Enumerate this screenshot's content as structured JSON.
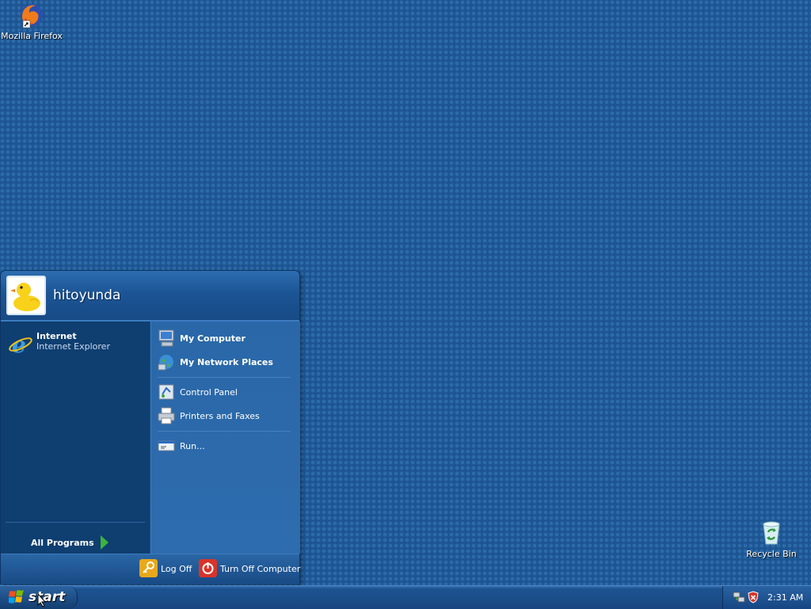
{
  "desktop": {
    "icons": [
      {
        "label": "Mozilla Firefox",
        "icon": "firefox-icon"
      },
      {
        "label": "Recycle Bin",
        "icon": "recycle-bin-icon"
      }
    ]
  },
  "start_menu": {
    "username": "hitoyunda",
    "pinned": [
      {
        "title": "Internet",
        "subtitle": "Internet Explorer",
        "icon": "internet-explorer-icon"
      }
    ],
    "all_programs_label": "All Programs",
    "right_items": [
      {
        "label": "My Computer",
        "icon": "my-computer-icon",
        "bold": true
      },
      {
        "label": "My Network Places",
        "icon": "network-places-icon",
        "bold": true
      },
      {
        "label": "Control Panel",
        "icon": "control-panel-icon",
        "bold": false
      },
      {
        "label": "Printers and Faxes",
        "icon": "printer-icon",
        "bold": false
      },
      {
        "label": "Run...",
        "icon": "run-icon",
        "bold": false
      }
    ],
    "footer": {
      "log_off_label": "Log Off",
      "turn_off_label": "Turn Off Computer"
    }
  },
  "taskbar": {
    "start_label": "start",
    "clock": "2:31 AM",
    "tray_icons": [
      "network-connection-icon",
      "security-alert-icon"
    ]
  },
  "colors": {
    "desktop_bg": "#1d5592",
    "start_menu_left": "#0f3e70",
    "start_menu_right": "#2a67a8",
    "taskbar": "#1a4b86"
  }
}
